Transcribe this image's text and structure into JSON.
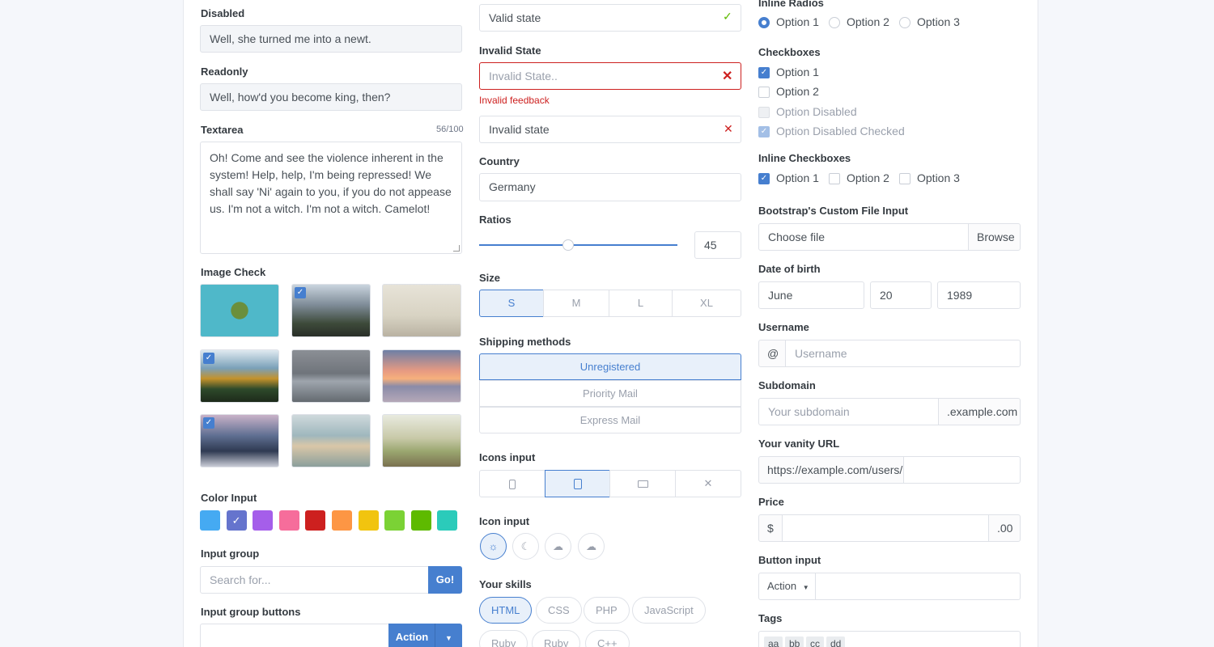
{
  "col1": {
    "disabled": {
      "label": "Disabled",
      "value": "Well, she turned me into a newt."
    },
    "readonly": {
      "label": "Readonly",
      "value": "Well, how'd you become king, then?"
    },
    "textarea": {
      "label": "Textarea",
      "counter": "56/100",
      "value": "Oh! Come and see the violence inherent in the system! Help, help, I'm being repressed! We shall say 'Ni' again to you, if you do not appease us. I'm not a witch. I'm not a witch. Camelot!"
    },
    "image_check": {
      "label": "Image Check",
      "checked": [
        false,
        true,
        false,
        true,
        false,
        false,
        true,
        false,
        false
      ]
    },
    "color_input": {
      "label": "Color Input",
      "colors": [
        "#45aaf2",
        "#6574cd",
        "#a55eea",
        "#f66d9b",
        "#cd201f",
        "#fd9644",
        "#f1c40f",
        "#7bd235",
        "#5eba00",
        "#2bcbba"
      ],
      "selected_index": 1
    },
    "input_group": {
      "label": "Input group",
      "placeholder": "Search for...",
      "button": "Go!"
    },
    "input_group_buttons": {
      "label": "Input group buttons",
      "button": "Action"
    }
  },
  "col2": {
    "valid": {
      "value": "Valid state"
    },
    "invalid": {
      "label": "Invalid State",
      "placeholder": "Invalid State..",
      "feedback": "Invalid feedback"
    },
    "invalid2": {
      "value": "Invalid state"
    },
    "country": {
      "label": "Country",
      "value": "Germany"
    },
    "ratios": {
      "label": "Ratios",
      "value": "45",
      "fraction": 0.45
    },
    "size": {
      "label": "Size",
      "options": [
        "S",
        "M",
        "L",
        "XL"
      ],
      "selected": "S"
    },
    "shipping": {
      "label": "Shipping methods",
      "options": [
        "Unregistered",
        "Priority Mail",
        "Express Mail"
      ],
      "selected": "Unregistered"
    },
    "icons_input": {
      "label": "Icons input",
      "icons": [
        "phone-icon",
        "tablet-icon",
        "monitor-icon",
        "x-icon"
      ],
      "selected": "tablet-icon"
    },
    "icon_input": {
      "label": "Icon input",
      "icons": [
        "sun-icon",
        "moon-icon",
        "cloud-rain-icon",
        "cloud-icon"
      ],
      "selected": "sun-icon"
    },
    "skills": {
      "label": "Your skills",
      "items": [
        "HTML",
        "CSS",
        "PHP",
        "JavaScript",
        "Ruby",
        "Ruby",
        "C++"
      ],
      "selected": [
        "HTML"
      ]
    }
  },
  "col3": {
    "inline_radios": {
      "label": "Inline Radios",
      "options": [
        "Option 1",
        "Option 2",
        "Option 3"
      ],
      "selected": "Option 1"
    },
    "checkboxes": {
      "label": "Checkboxes",
      "options": [
        "Option 1",
        "Option 2",
        "Option Disabled",
        "Option Disabled Checked"
      ]
    },
    "inline_checkboxes": {
      "label": "Inline Checkboxes",
      "options": [
        "Option 1",
        "Option 2",
        "Option 3"
      ]
    },
    "file": {
      "label": "Bootstrap's Custom File Input",
      "value": "Choose file",
      "button": "Browse"
    },
    "dob": {
      "label": "Date of birth",
      "month": "June",
      "day": "20",
      "year": "1989"
    },
    "username": {
      "label": "Username",
      "addon": "@",
      "placeholder": "Username"
    },
    "subdomain": {
      "label": "Subdomain",
      "placeholder": "Your subdomain",
      "addon": ".example.com"
    },
    "vanity": {
      "label": "Your vanity URL",
      "addon": "https://example.com/users/"
    },
    "price": {
      "label": "Price",
      "prefix": "$",
      "suffix": ".00"
    },
    "button_input": {
      "label": "Button input",
      "button": "Action"
    },
    "tags": {
      "label": "Tags",
      "items": [
        "aa",
        "bb",
        "cc",
        "dd"
      ]
    }
  }
}
